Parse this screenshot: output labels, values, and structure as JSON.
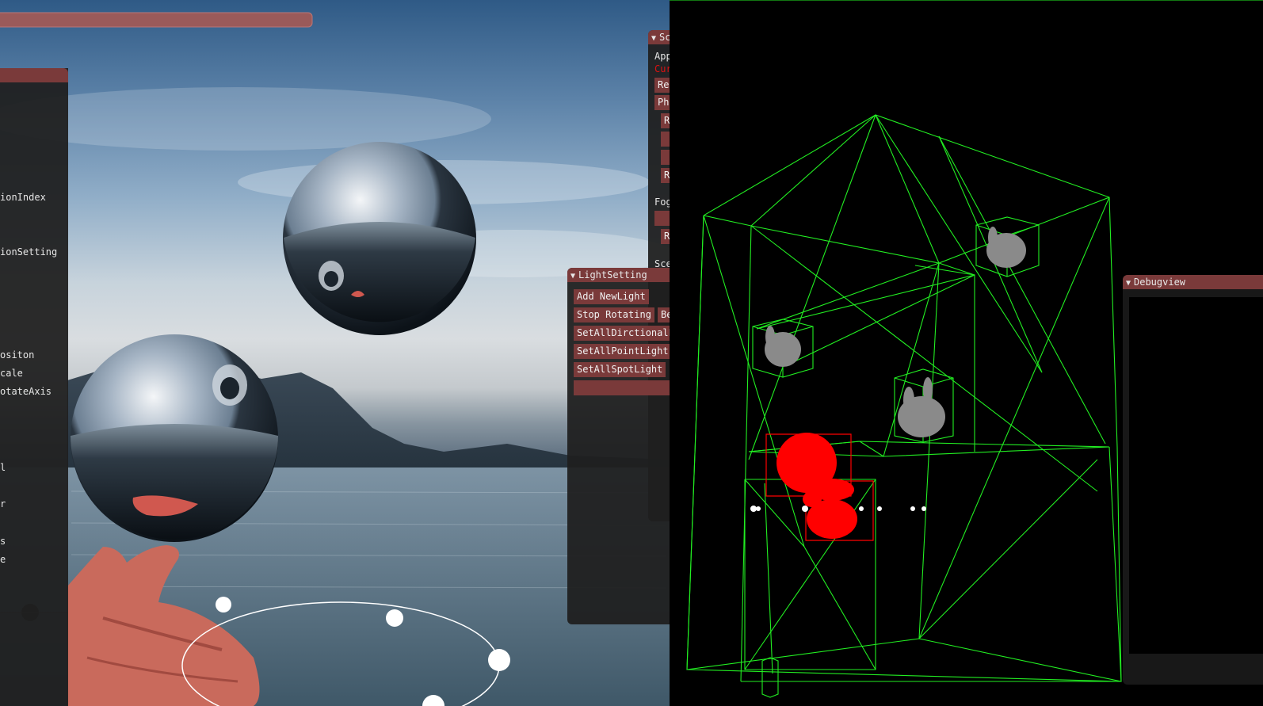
{
  "scene_left": {
    "main_panel_labels": [
      "ionIndex",
      "ionSetting",
      "ositon",
      "cale",
      "otateAxis",
      "l",
      "r",
      "s",
      "e"
    ]
  },
  "scene_window": {
    "title": "Sc",
    "labels": [
      "App",
      "Cur",
      "Fog",
      "Sce",
      "S"
    ],
    "buttons": [
      "Rel",
      "Pho",
      "R",
      "",
      "",
      "R",
      "",
      "R"
    ]
  },
  "light_setting": {
    "title": "LightSetting",
    "buttons": {
      "add_new_light": "Add NewLight",
      "stop_rotating": "Stop Rotating",
      "be": "Be",
      "set_all_directional": "SetAllDirctionalL",
      "set_all_point": "SetAllPointLight",
      "set_all_spot": "SetAllSpotLight"
    }
  },
  "debugview": {
    "title": "Debugview"
  },
  "colors": {
    "imgui_title": "#7a3a3a",
    "imgui_bg": "#1f1f1f",
    "wireframe": "#22ee22",
    "highlight": "#ff0000"
  },
  "icons": {
    "collapse": "triangle-down-icon"
  }
}
